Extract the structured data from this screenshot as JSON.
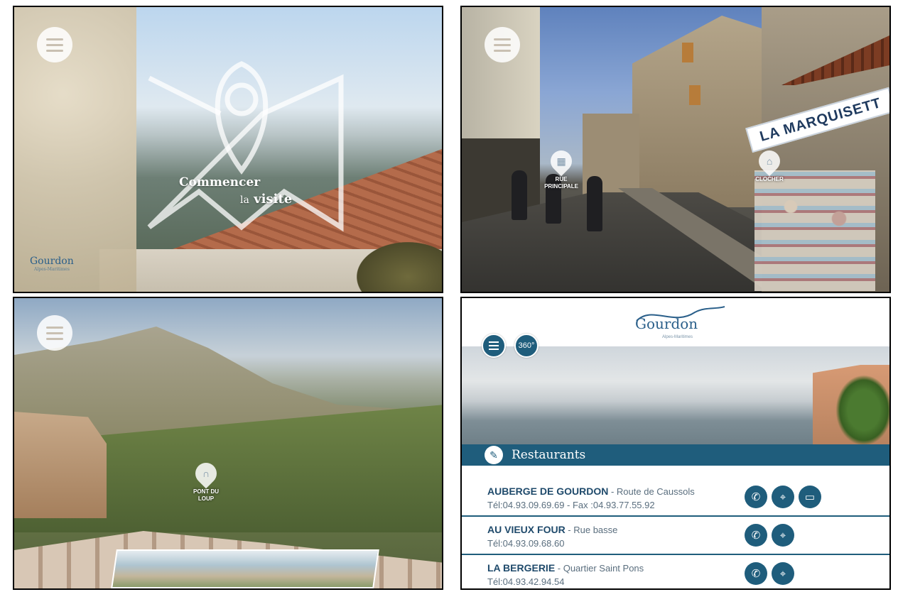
{
  "panel1": {
    "menu_icon": "hamburger-menu-icon",
    "cta_line1": "Commencer",
    "cta_line2_small": "la",
    "cta_line2": "visite",
    "logo": "Gourdon",
    "logo_sub": "Alpes-Maritimes"
  },
  "panel2": {
    "menu_icon": "hamburger-menu-icon",
    "sign": "LA MARQUISETT",
    "hotspots": [
      {
        "label": "RUE PRINCIPALE",
        "icon": "street-icon"
      },
      {
        "label": "CLOCHER",
        "icon": "bell-tower-icon"
      }
    ]
  },
  "panel3": {
    "menu_icon": "hamburger-menu-icon",
    "hotspot": {
      "label": "PONT DU LOUP",
      "icon": "bridge-icon"
    }
  },
  "panel4": {
    "logo": "Gourdon",
    "logo_sub": "Alpes-Maritimes",
    "menu_icon": "hamburger-menu-icon",
    "view360_label": "360°",
    "section_icon": "restaurant-icon",
    "section_title": "Restaurants",
    "restaurants": [
      {
        "name": "AUBERGE DE GOURDON",
        "address": " - Route de Caussols",
        "tel": "Tél:04.93.09.69.69 - Fax :04.93.77.55.92",
        "actions": [
          "phone-icon",
          "map-marker-icon",
          "website-icon"
        ]
      },
      {
        "name": "AU VIEUX FOUR",
        "address": " - Rue basse",
        "tel": "Tél:04.93.09.68.60",
        "actions": [
          "phone-icon",
          "map-marker-icon"
        ]
      },
      {
        "name": "LA BERGERIE",
        "address": " - Quartier Saint Pons",
        "tel": "Tél:04.93.42.94.54",
        "actions": [
          "phone-icon",
          "map-marker-icon"
        ]
      }
    ]
  },
  "colors": {
    "brand_blue": "#1f5d7c",
    "logo_blue": "#2a5f8a"
  }
}
